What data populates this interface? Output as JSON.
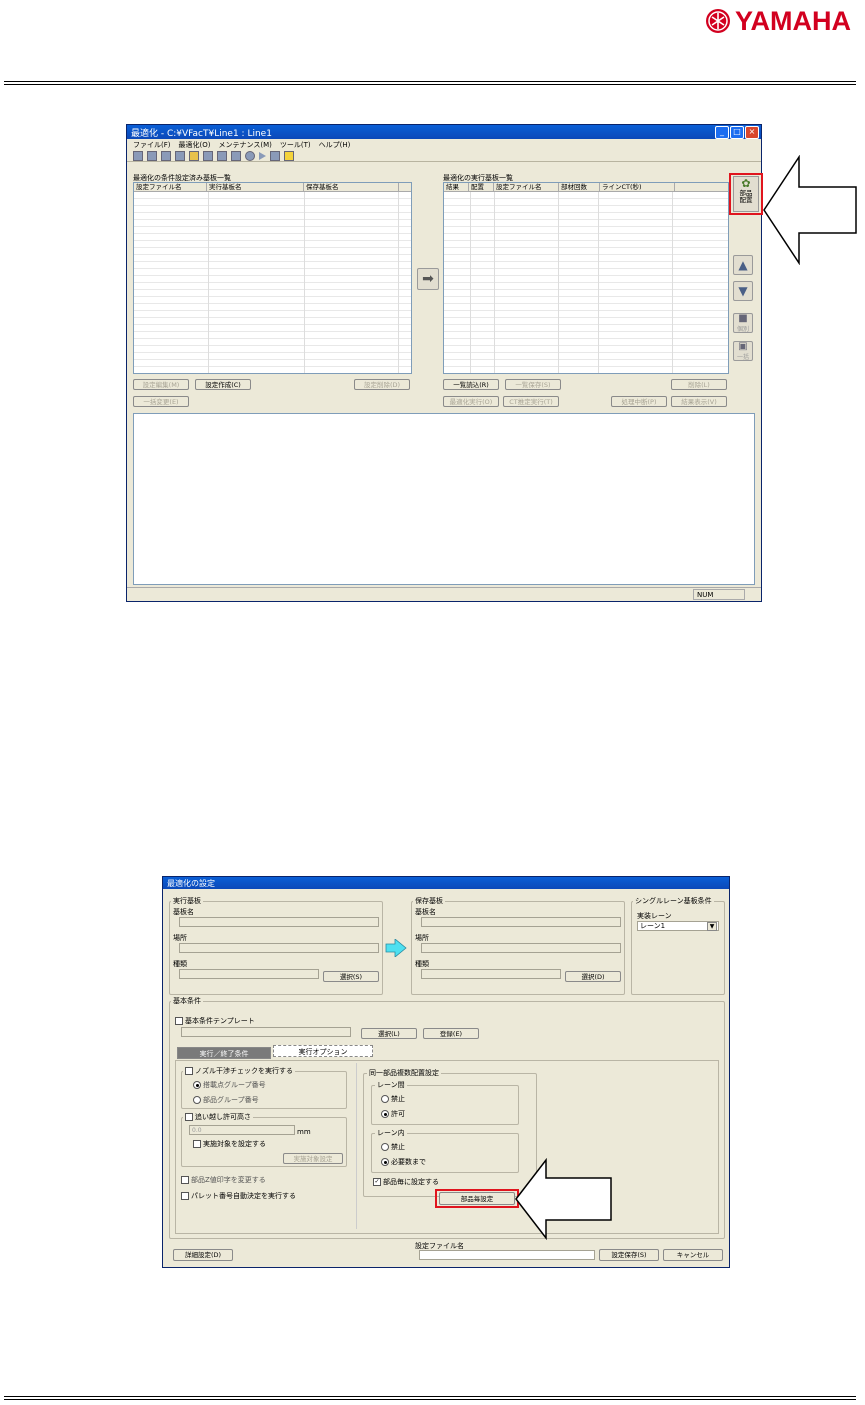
{
  "header": {
    "logo_text": "YAMAHA",
    "brand_color": "#d2001f"
  },
  "window1": {
    "title": "最適化 - C:¥VFacT¥Line1 : Line1",
    "menu": [
      "ファイル(F)",
      "最適化(O)",
      "メンテナンス(M)",
      "ツール(T)",
      "ヘルプ(H)"
    ],
    "left_panel_label": "最適化の条件設定済み基板一覧",
    "left_columns": [
      "設定ファイル名",
      "実行基板名",
      "保存基板名"
    ],
    "right_panel_label": "最適化の実行基板一覧",
    "right_columns": [
      "結果",
      "配置",
      "設定ファイル名",
      "部材回数",
      "ラインCT(秒)"
    ],
    "left_buttons": {
      "edit": "設定編集(M)",
      "create": "設定作成(C)",
      "delete": "設定削除(D)",
      "batch": "一括変更(E)"
    },
    "right_buttons": {
      "batch_load": "一覧読込(R)",
      "batch_save": "一覧保存(S)",
      "remove": "削除(L)",
      "run_opt": "最適化実行(O)",
      "ct_run": "CT推定実行(T)",
      "abort": "処理中断(P)",
      "show_result": "結果表示(V)"
    },
    "side_buttons": {
      "assign_line1": "部品",
      "assign_line2": "配置",
      "individual": "個別",
      "batch": "一括"
    },
    "status_num": "NUM"
  },
  "dialog": {
    "title": "最適化の設定",
    "exec_board": {
      "title": "実行基板",
      "board_name": "基板名",
      "location": "場所",
      "type": "種類",
      "select": "選択(S)"
    },
    "save_board": {
      "title": "保存基板",
      "board_name": "基板名",
      "location": "場所",
      "type": "種類",
      "select": "選択(D)"
    },
    "single_lane": {
      "title": "シングルレーン基板条件",
      "lane_label": "実装レーン",
      "lane_value": "レーン1"
    },
    "basic": {
      "title": "基本条件",
      "template_label": "基本条件テンプレート",
      "select": "選択(L)",
      "register": "登録(E)"
    },
    "tabs": {
      "exec_end": "実行／終了条件",
      "exec_option": "実行オプション"
    },
    "nozzle": {
      "label": "ノズル干渉チェックを実行する",
      "opt1": "搭載点グループ番号",
      "opt2": "部品グループ番号"
    },
    "allowance": {
      "label": "追い越し許可高さ",
      "value": "0.0",
      "unit": "mm",
      "set_target": "実施対象を設定する",
      "target_button": "実施対象設定"
    },
    "misc": {
      "change_z": "部品Z値印字を変更する",
      "pallet_auto": "パレット番号自動決定を実行する"
    },
    "multi": {
      "title": "同一部品複数配置設定",
      "between_title": "レーン間",
      "between_opt1": "禁止",
      "between_opt2": "許可",
      "within_title": "レーン内",
      "within_opt1": "禁止",
      "within_opt2": "必要数まで",
      "per_part": "部品毎に設定する",
      "per_part_button": "部品毎設定"
    },
    "footer": {
      "detail": "詳細設定(D)",
      "filename_label": "設定ファイル名",
      "save": "設定保存(S)",
      "cancel": "キャンセル"
    }
  }
}
